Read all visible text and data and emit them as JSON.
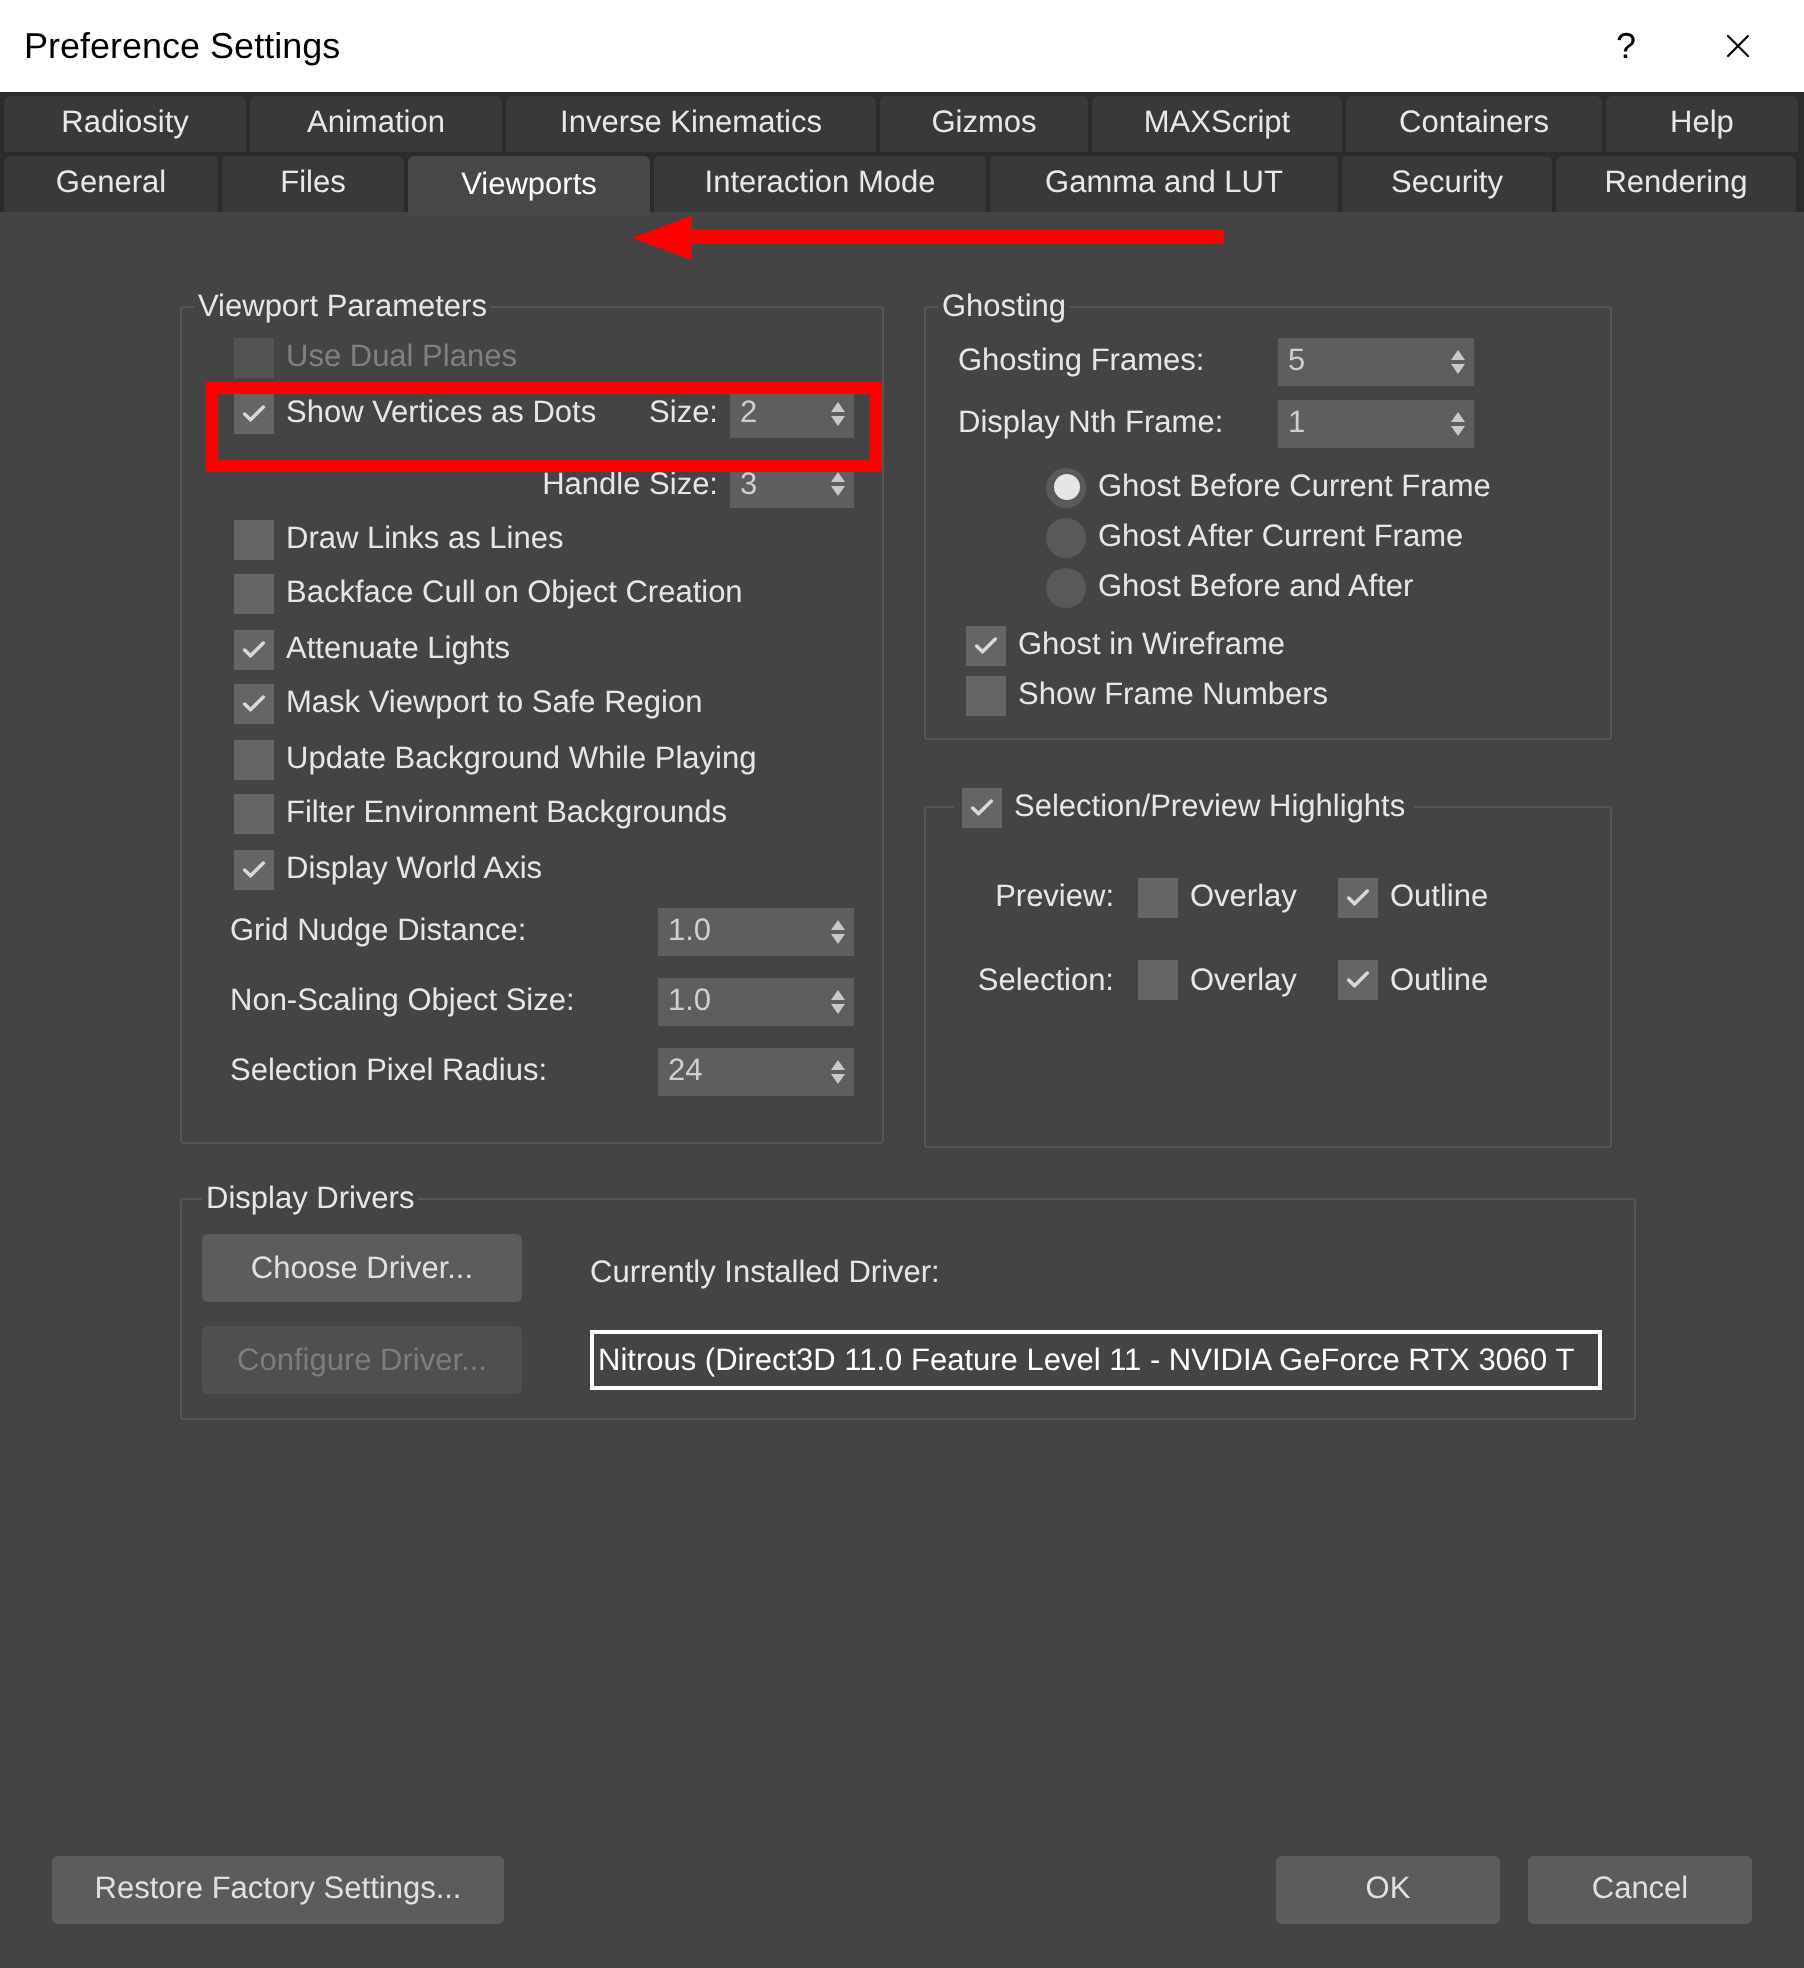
{
  "window": {
    "title": "Preference Settings",
    "help": "?"
  },
  "tabs": [
    [
      {
        "label": "Radiosity",
        "selected": false
      },
      {
        "label": "Animation",
        "selected": false
      },
      {
        "label": "Inverse Kinematics",
        "selected": false
      },
      {
        "label": "Gizmos",
        "selected": false
      },
      {
        "label": "MAXScript",
        "selected": false
      },
      {
        "label": "Containers",
        "selected": false
      },
      {
        "label": "Help",
        "selected": false
      }
    ],
    [
      {
        "label": "General",
        "selected": false
      },
      {
        "label": "Files",
        "selected": false
      },
      {
        "label": "Viewports",
        "selected": true
      },
      {
        "label": "Interaction Mode",
        "selected": false
      },
      {
        "label": "Gamma and LUT",
        "selected": false
      },
      {
        "label": "Security",
        "selected": false
      },
      {
        "label": "Rendering",
        "selected": false
      }
    ]
  ],
  "viewport_parameters": {
    "title": "Viewport Parameters",
    "items": [
      {
        "kind": "checkbox",
        "label": "Use Dual Planes",
        "checked": false,
        "disabled": true
      },
      {
        "kind": "checkbox_spinner",
        "label": "Show Vertices as Dots",
        "checked": true,
        "disabled": false,
        "spinner_label": "Size:",
        "value": "2"
      },
      {
        "kind": "spinner_right",
        "label": "Handle Size:",
        "value": "3"
      },
      {
        "kind": "checkbox",
        "label": "Draw Links as Lines",
        "checked": false,
        "disabled": false
      },
      {
        "kind": "checkbox",
        "label": "Backface Cull on Object Creation",
        "checked": false,
        "disabled": false
      },
      {
        "kind": "checkbox",
        "label": "Attenuate Lights",
        "checked": true,
        "disabled": false
      },
      {
        "kind": "checkbox",
        "label": "Mask Viewport to Safe Region",
        "checked": true,
        "disabled": false
      },
      {
        "kind": "checkbox",
        "label": "Update Background While Playing",
        "checked": false,
        "disabled": false
      },
      {
        "kind": "checkbox",
        "label": "Filter Environment Backgrounds",
        "checked": false,
        "disabled": false
      },
      {
        "kind": "checkbox",
        "label": "Display World Axis",
        "checked": true,
        "disabled": false
      },
      {
        "kind": "spinner",
        "label": "Grid Nudge Distance:",
        "value": "1.0"
      },
      {
        "kind": "spinner",
        "label": "Non-Scaling Object Size:",
        "value": "1.0"
      },
      {
        "kind": "spinner",
        "label": "Selection Pixel Radius:",
        "value": "24"
      }
    ]
  },
  "ghosting": {
    "title": "Ghosting",
    "spinners": [
      {
        "label": "Ghosting Frames:",
        "value": "5"
      },
      {
        "label": "Display Nth Frame:",
        "value": "1"
      }
    ],
    "radios": [
      {
        "label": "Ghost Before Current Frame",
        "selected": true
      },
      {
        "label": "Ghost After Current Frame",
        "selected": false
      },
      {
        "label": "Ghost Before and After",
        "selected": false
      }
    ],
    "checkboxes": [
      {
        "label": "Ghost in Wireframe",
        "checked": true
      },
      {
        "label": "Show Frame Numbers",
        "checked": false
      }
    ]
  },
  "highlights": {
    "title": "Selection/Preview Highlights",
    "checked": true,
    "rows": [
      {
        "label": "Preview:",
        "options": [
          {
            "label": "Overlay",
            "checked": false
          },
          {
            "label": "Outline",
            "checked": true
          }
        ]
      },
      {
        "label": "Selection:",
        "options": [
          {
            "label": "Overlay",
            "checked": false
          },
          {
            "label": "Outline",
            "checked": true
          }
        ]
      }
    ]
  },
  "display_drivers": {
    "title": "Display Drivers",
    "buttons": [
      {
        "label": "Choose Driver...",
        "disabled": false
      },
      {
        "label": "Configure Driver...",
        "disabled": true
      }
    ],
    "installed_label": "Currently Installed Driver:",
    "installed_value": "Nitrous (Direct3D 11.0 Feature Level 11 - NVIDIA GeForce RTX 3060 T"
  },
  "footer": {
    "restore": "Restore Factory Settings...",
    "ok": "OK",
    "cancel": "Cancel"
  }
}
